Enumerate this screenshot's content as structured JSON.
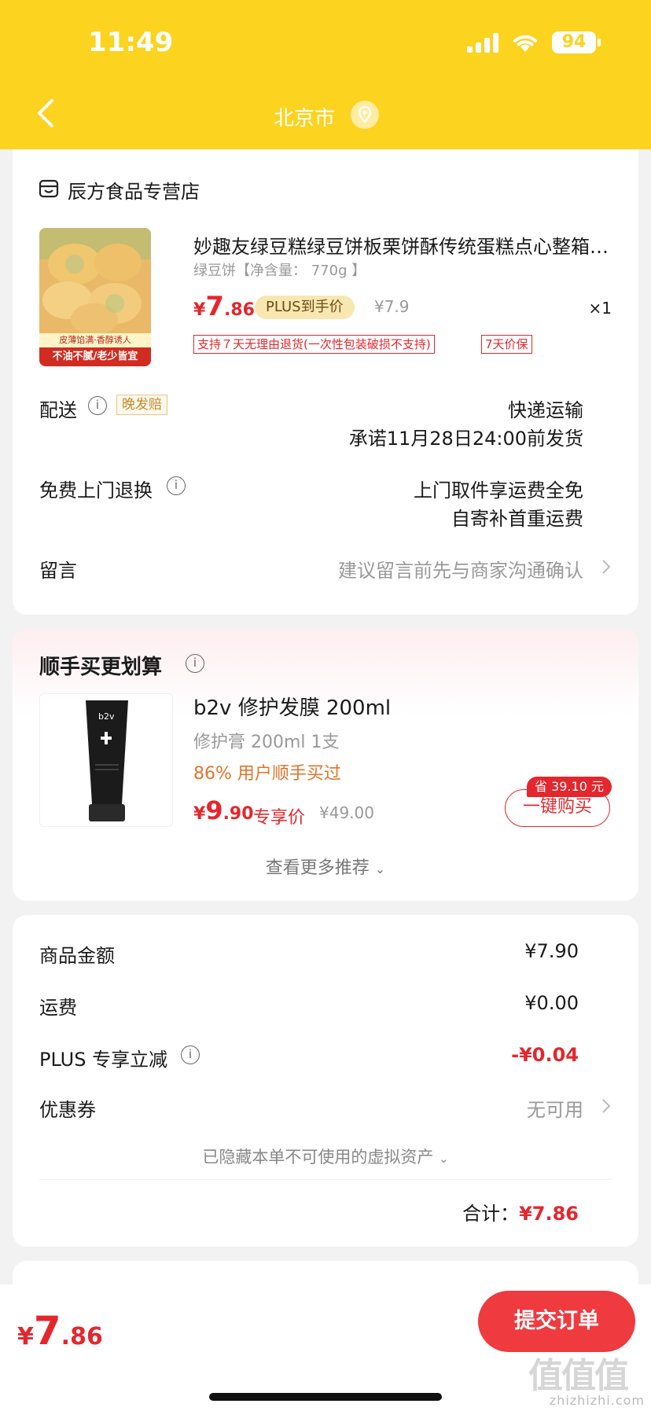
{
  "status_bar": {
    "time": "11:49",
    "battery": "94"
  },
  "nav": {
    "city": "北京市"
  },
  "store": {
    "name": "辰方食品专营店",
    "product": {
      "title": "妙趣友绿豆糕绿豆饼板栗饼酥传统蛋糕点心整箱早餐零食品网红零嘴",
      "spec": "绿豆饼【净含量： 770g 】",
      "price_symbol": "¥",
      "price_int": "7",
      "price_dec": ".86",
      "plus_badge": "PLUS到手价",
      "original_price": "¥7.9",
      "quantity": "×1",
      "image_caption_1": "皮薄馅满·香醇诱人",
      "image_caption_2": "不油不腻/老少皆宜",
      "policies": [
        "支持７天无理由退货(一次性包装破损不支持)",
        "7天价保"
      ]
    },
    "delivery": {
      "label": "配送",
      "badge": "晚发赔",
      "method": "快递运输",
      "promise": "承诺11月28日24:00前发货"
    },
    "return": {
      "label": "免费上门退换",
      "line1": "上门取件享运费全免",
      "line2": "自寄补首重运费"
    },
    "message": {
      "label": "留言",
      "hint": "建议留言前先与商家沟通确认"
    }
  },
  "recommend": {
    "title": "顺手买更划算",
    "item": {
      "name": "b2v 修护发膜 200ml",
      "spec": "修护膏 200ml 1支",
      "bought": "86% 用户顺手买过",
      "price_symbol": "¥",
      "price_int": "9",
      "price_dec": ".90",
      "exclusive": "专享价",
      "original_price": "¥49.00",
      "save_badge": "省 39.10 元",
      "buy_button": "一键购买",
      "brand_mark": "b2v"
    },
    "more": "查看更多推荐"
  },
  "summary": {
    "goods_label": "商品金额",
    "goods_value": "¥7.90",
    "shipping_label": "运费",
    "shipping_value": "¥0.00",
    "plus_label": "PLUS 专享立减",
    "plus_value": "-¥0.04",
    "coupon_label": "优惠券",
    "coupon_value": "无可用",
    "hidden_note": "已隐藏本单不可使用的虚拟资产",
    "total_label": "合计：",
    "total_value": "¥7.86"
  },
  "bottom": {
    "price_symbol": "¥",
    "price_int": "7",
    "price_dec": ".86",
    "submit": "提交订单",
    "watermark": "zhizhizhi.com",
    "watermark_mark": "值值值"
  },
  "colors": {
    "header": "#fcd31f",
    "accent_red": "#e4272d",
    "plus_gold": "#f8e7b0"
  }
}
